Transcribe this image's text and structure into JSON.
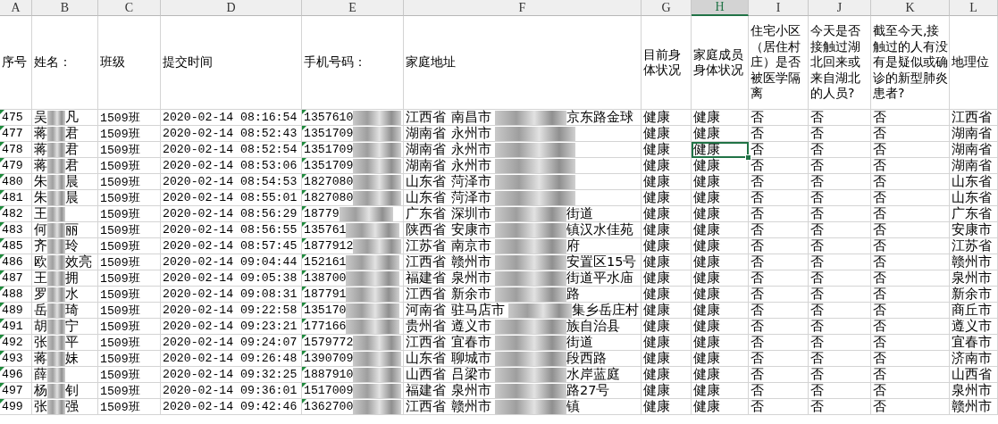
{
  "columns": [
    {
      "letter": "A",
      "title": "序号",
      "selected": false
    },
    {
      "letter": "B",
      "title": "姓名：",
      "selected": false
    },
    {
      "letter": "C",
      "title": "班级",
      "selected": false
    },
    {
      "letter": "D",
      "title": "提交时间",
      "selected": false
    },
    {
      "letter": "E",
      "title": "手机号码：",
      "selected": false
    },
    {
      "letter": "F",
      "title": "家庭地址",
      "selected": false
    },
    {
      "letter": "G",
      "title": "目前身体状况",
      "selected": false
    },
    {
      "letter": "H",
      "title": "家庭成员身体状况",
      "selected": true
    },
    {
      "letter": "I",
      "title": "住宅小区（居住村庄）是否被医学隔离",
      "selected": false
    },
    {
      "letter": "J",
      "title": "今天是否接触过湖北回来或来自湖北的人员?",
      "selected": false
    },
    {
      "letter": "K",
      "title": "截至今天,接触过的人有没有是疑似或确诊的新型肺炎患者?",
      "selected": false
    },
    {
      "letter": "L",
      "title": "地理位",
      "selected": false
    }
  ],
  "rows": [
    {
      "no": "475",
      "name_first": "吴",
      "name_last": "凡",
      "class": "1509班",
      "time": "2020-02-14 08:16:54",
      "phone": "1357610",
      "province": "江西省",
      "city": "南昌市",
      "address_tail": "京东路金球",
      "health": "健康",
      "family_health": "健康",
      "selected": false,
      "quarantine": "否",
      "hubei_contact": "否",
      "suspected_contact": "否",
      "location": "江西省"
    },
    {
      "no": "477",
      "name_first": "蒋",
      "name_last": "君",
      "class": "1509班",
      "time": "2020-02-14 08:52:43",
      "phone": "1351709",
      "province": "湖南省",
      "city": "永州市",
      "health": "健康",
      "family_health": "健康",
      "selected": false,
      "quarantine": "否",
      "hubei_contact": "否",
      "suspected_contact": "否",
      "location": "湖南省"
    },
    {
      "no": "478",
      "name_first": "蒋",
      "name_last": "君",
      "class": "1509班",
      "time": "2020-02-14 08:52:54",
      "phone": "1351709",
      "province": "湖南省",
      "city": "永州市",
      "health": "健康",
      "family_health": "健康",
      "selected": true,
      "quarantine": "否",
      "hubei_contact": "否",
      "suspected_contact": "否",
      "location": "湖南省"
    },
    {
      "no": "479",
      "name_first": "蒋",
      "name_last": "君",
      "class": "1509班",
      "time": "2020-02-14 08:53:06",
      "phone": "1351709",
      "province": "湖南省",
      "city": "永州市",
      "health": "健康",
      "family_health": "健康",
      "selected": false,
      "quarantine": "否",
      "hubei_contact": "否",
      "suspected_contact": "否",
      "location": "湖南省"
    },
    {
      "no": "480",
      "name_first": "朱",
      "name_last": "晨",
      "class": "1509班",
      "time": "2020-02-14 08:54:53",
      "phone": "1827080",
      "province": "山东省",
      "city": "菏泽市",
      "health": "健康",
      "family_health": "健康",
      "selected": false,
      "quarantine": "否",
      "hubei_contact": "否",
      "suspected_contact": "否",
      "location": "山东省"
    },
    {
      "no": "481",
      "name_first": "朱",
      "name_last": "晨",
      "class": "1509班",
      "time": "2020-02-14 08:55:01",
      "phone": "1827080",
      "province": "山东省",
      "city": "菏泽市",
      "health": "健康",
      "family_health": "健康",
      "selected": false,
      "quarantine": "否",
      "hubei_contact": "否",
      "suspected_contact": "否",
      "location": "山东省"
    },
    {
      "no": "482",
      "name_first": "王",
      "class": "1509班",
      "time": "2020-02-14 08:56:29",
      "phone": "18779",
      "province": "广东省",
      "city": "深圳市",
      "address_tail": "街道",
      "health": "健康",
      "family_health": "健康",
      "selected": false,
      "quarantine": "否",
      "hubei_contact": "否",
      "suspected_contact": "否",
      "location": "广东省"
    },
    {
      "no": "483",
      "name_first": "何",
      "name_last": "丽",
      "class": "1509班",
      "time": "2020-02-14 08:56:55",
      "phone": "135761",
      "province": "陕西省",
      "city": "安康市",
      "address_tail": "镇汉水佳苑",
      "health": "健康",
      "family_health": "健康",
      "selected": false,
      "quarantine": "否",
      "hubei_contact": "否",
      "suspected_contact": "否",
      "location": "安康市"
    },
    {
      "no": "485",
      "name_first": "齐",
      "name_last": "玲",
      "class": "1509班",
      "time": "2020-02-14 08:57:45",
      "phone": "1877912",
      "province": "江苏省",
      "city": "南京市",
      "address_tail": "府",
      "health": "健康",
      "family_health": "健康",
      "selected": false,
      "quarantine": "否",
      "hubei_contact": "否",
      "suspected_contact": "否",
      "location": "江苏省"
    },
    {
      "no": "486",
      "name_first": "欧",
      "name_last": "效亮",
      "class": "1509班",
      "time": "2020-02-14 09:04:44",
      "phone": "152161",
      "province": "江西省",
      "city": "赣州市",
      "address_tail": "安置区15号",
      "health": "健康",
      "family_health": "健康",
      "selected": false,
      "quarantine": "否",
      "hubei_contact": "否",
      "suspected_contact": "否",
      "location": "赣州市"
    },
    {
      "no": "487",
      "name_first": "王",
      "name_last": "拥",
      "class": "1509班",
      "time": "2020-02-14 09:05:38",
      "phone": "138700",
      "province": "福建省",
      "city": "泉州市",
      "address_tail": "街道平水庙",
      "health": "健康",
      "family_health": "健康",
      "selected": false,
      "quarantine": "否",
      "hubei_contact": "否",
      "suspected_contact": "否",
      "location": "泉州市"
    },
    {
      "no": "488",
      "name_first": "罗",
      "name_last": "水",
      "class": "1509班",
      "time": "2020-02-14 09:08:31",
      "phone": "187791",
      "province": "江西省",
      "city": "新余市",
      "address_tail": "路",
      "health": "健康",
      "family_health": "健康",
      "selected": false,
      "quarantine": "否",
      "hubei_contact": "否",
      "suspected_contact": "否",
      "location": "新余市"
    },
    {
      "no": "489",
      "name_first": "岳",
      "name_last": "琦",
      "class": "1509班",
      "time": "2020-02-14 09:22:58",
      "phone": "135170",
      "province": "河南省",
      "city": "驻马店市",
      "address_tail": "集乡岳庄村",
      "health": "健康",
      "family_health": "健康",
      "selected": false,
      "quarantine": "否",
      "hubei_contact": "否",
      "suspected_contact": "否",
      "location": "商丘市"
    },
    {
      "no": "491",
      "name_first": "胡",
      "name_last": "宁",
      "class": "1509班",
      "time": "2020-02-14 09:23:21",
      "phone": "177166",
      "province": "贵州省",
      "city": "遵义市",
      "address_tail": "族自治县",
      "health": "健康",
      "family_health": "健康",
      "selected": false,
      "quarantine": "否",
      "hubei_contact": "否",
      "suspected_contact": "否",
      "location": "遵义市"
    },
    {
      "no": "492",
      "name_first": "张",
      "name_last": "平",
      "class": "1509班",
      "time": "2020-02-14 09:24:07",
      "phone": "1579772",
      "province": "江西省",
      "city": "宜春市",
      "address_tail": "街道",
      "health": "健康",
      "family_health": "健康",
      "selected": false,
      "quarantine": "否",
      "hubei_contact": "否",
      "suspected_contact": "否",
      "location": "宜春市"
    },
    {
      "no": "493",
      "name_first": "蒋",
      "name_last": "妹",
      "class": "1509班",
      "time": "2020-02-14 09:26:48",
      "phone": "1390709",
      "province": "山东省",
      "city": "聊城市",
      "address_tail": "段西路",
      "health": "健康",
      "family_health": "健康",
      "selected": false,
      "quarantine": "否",
      "hubei_contact": "否",
      "suspected_contact": "否",
      "location": "济南市"
    },
    {
      "no": "496",
      "name_first": "薛",
      "class": "1509班",
      "time": "2020-02-14 09:32:25",
      "phone": "1887910",
      "province": "山西省",
      "city": "吕梁市",
      "address_tail": "水岸蓝庭",
      "health": "健康",
      "family_health": "健康",
      "selected": false,
      "quarantine": "否",
      "hubei_contact": "否",
      "suspected_contact": "否",
      "location": "山西省"
    },
    {
      "no": "497",
      "name_first": "杨",
      "name_last": "钊",
      "class": "1509班",
      "time": "2020-02-14 09:36:01",
      "phone": "1517009",
      "province": "福建省",
      "city": "泉州市",
      "address_tail": "路27号",
      "health": "健康",
      "family_health": "健康",
      "selected": false,
      "quarantine": "否",
      "hubei_contact": "否",
      "suspected_contact": "否",
      "location": "泉州市"
    },
    {
      "no": "499",
      "name_first": "张",
      "name_last": "强",
      "class": "1509班",
      "time": "2020-02-14 09:42:46",
      "phone": "1362700",
      "province": "江西省",
      "city": "赣州市",
      "address_tail": "镇",
      "health": "健康",
      "family_health": "健康",
      "selected": false,
      "quarantine": "否",
      "hubei_contact": "否",
      "suspected_contact": "否",
      "location": "赣州市"
    }
  ]
}
